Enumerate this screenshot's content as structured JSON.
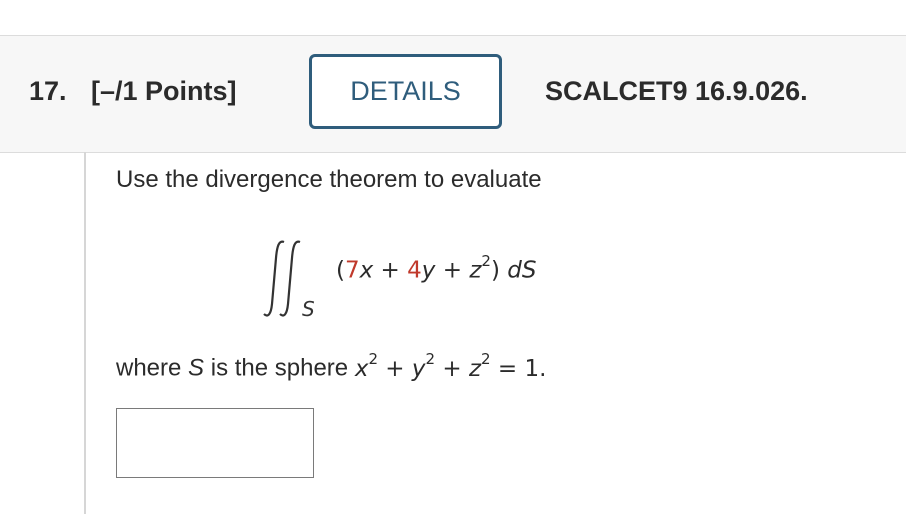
{
  "question": {
    "number": "17.",
    "points": "[–/1 Points]",
    "details_label": "DETAILS",
    "reference": "SCALCET9 16.9.026."
  },
  "problem": {
    "instruction": "Use the divergence theorem to evaluate",
    "integral": {
      "subscript": "S",
      "open": "(",
      "term1_coef": "7",
      "term1_var": "x",
      "plus1": " + ",
      "term2_coef": "4",
      "term2_var": "y",
      "plus2": " + ",
      "term3_var": "z",
      "term3_exp": "2",
      "close": ")",
      "differential": "dS"
    },
    "where_text": "where ",
    "where_var": "S",
    "where_mid": " is the sphere ",
    "sphere": {
      "x": "x",
      "x_exp": "2",
      "plus1": " + ",
      "y": "y",
      "y_exp": "2",
      "plus2": " + ",
      "z": "z",
      "z_exp": "2",
      "equals": " = 1."
    }
  },
  "answer": {
    "value": "",
    "placeholder": ""
  },
  "colors": {
    "accent": "#2f5d7c",
    "highlight": "#c0392b",
    "header_bg": "#f7f7f7"
  }
}
